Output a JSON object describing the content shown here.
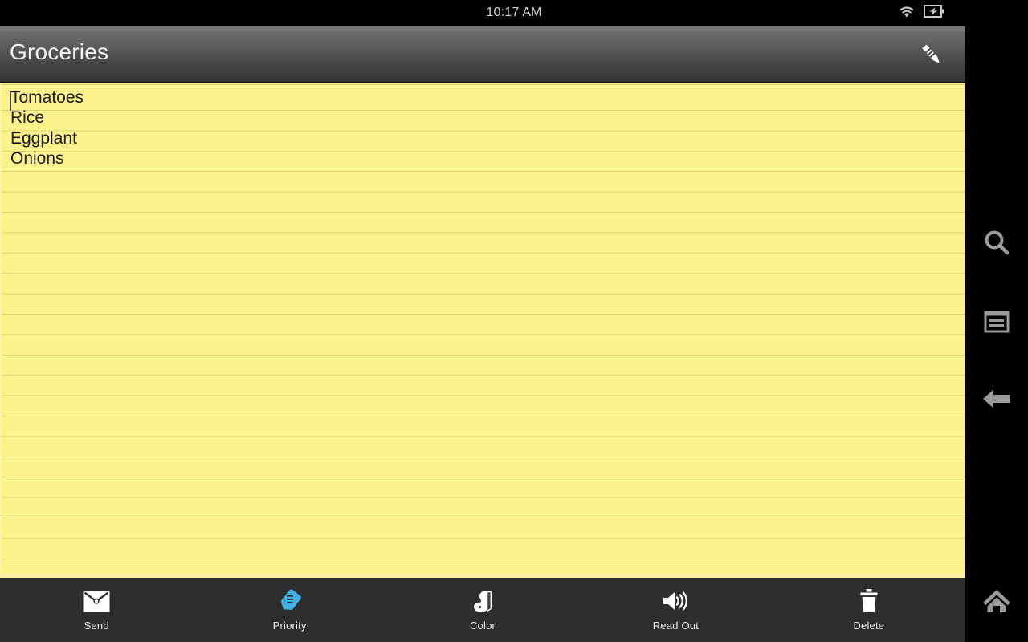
{
  "status_bar": {
    "time": "10:17 AM",
    "icons": [
      {
        "name": "wifi-icon",
        "label": "wifi"
      },
      {
        "name": "battery-charging-icon",
        "label": "battery charging"
      }
    ]
  },
  "title_bar": {
    "title": "Groceries",
    "edit_button": {
      "name": "edit-pencil-icon",
      "label": "Edit"
    }
  },
  "note": {
    "background_color": "#fdf18c",
    "line_color": "#baaa60",
    "text_color": "#1b1b1b",
    "content": "Tomatoes\nRice\nEggplant\nOnions",
    "items": [
      "Tomatoes",
      "Rice",
      "Eggplant",
      "Onions"
    ],
    "cursor_visible": true
  },
  "toolbar": {
    "background_color": "#2e2e2e",
    "items": [
      {
        "label": "Send",
        "icon": "envelope-icon",
        "color": "#ffffff"
      },
      {
        "label": "Priority",
        "icon": "marker-icon",
        "color": "#3fb2e4"
      },
      {
        "label": "Color",
        "icon": "palette-icon",
        "color": "#ffffff"
      },
      {
        "label": "Read Out",
        "icon": "speaker-icon",
        "color": "#ffffff"
      },
      {
        "label": "Delete",
        "icon": "trash-icon",
        "color": "#ffffff"
      }
    ]
  },
  "navbar": {
    "background_color": "#000000",
    "icon_color": "#9a9a9a",
    "items": [
      {
        "label": "Search",
        "icon": "search-icon"
      },
      {
        "label": "Menu",
        "icon": "menu-overview-icon"
      },
      {
        "label": "Back",
        "icon": "back-arrow-icon"
      },
      {
        "label": "Home",
        "icon": "home-icon"
      }
    ]
  }
}
